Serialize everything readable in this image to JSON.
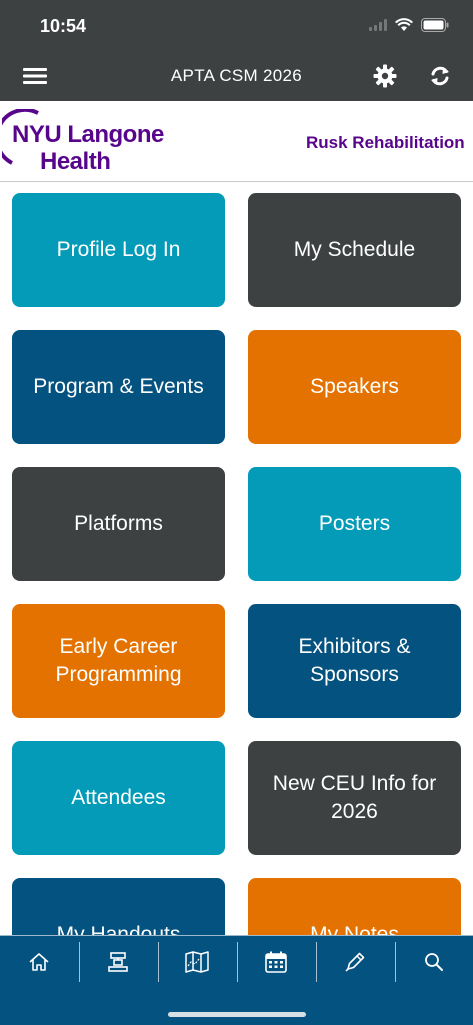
{
  "status": {
    "time": "10:54"
  },
  "nav": {
    "title": "APTA CSM 2026"
  },
  "banner": {
    "logo_line1": "NYU Langone",
    "logo_line2": "Health",
    "right_text": "Rusk Rehabilitation"
  },
  "tiles": [
    {
      "label": "Profile Log In",
      "color": "#039bb8"
    },
    {
      "label": "My Schedule",
      "color": "#3d4142"
    },
    {
      "label": "Program & Events",
      "color": "#04527f"
    },
    {
      "label": "Speakers",
      "color": "#e37200"
    },
    {
      "label": "Platforms",
      "color": "#3d4142"
    },
    {
      "label": "Posters",
      "color": "#039bb8"
    },
    {
      "label": "Early Career\nProgramming",
      "color": "#e37200"
    },
    {
      "label": "Exhibitors &\nSponsors",
      "color": "#04527f"
    },
    {
      "label": "Attendees",
      "color": "#039bb8"
    },
    {
      "label": "New CEU Info for\n2026",
      "color": "#3d4142"
    },
    {
      "label": "My Handouts",
      "color": "#04527f"
    },
    {
      "label": "My Notes",
      "color": "#e37200"
    }
  ],
  "tabbar": {
    "items": [
      "home-icon",
      "booth-icon",
      "map-icon",
      "calendar-icon",
      "pen-icon",
      "search-icon"
    ]
  },
  "colors": {
    "header": "#3d4142",
    "tabbar": "#04527f",
    "brand": "#57068c"
  }
}
